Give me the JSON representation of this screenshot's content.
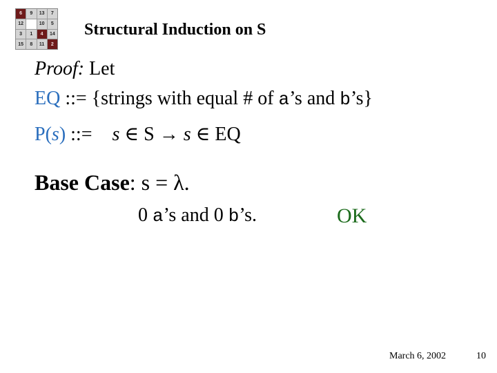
{
  "slide": {
    "title": "Structural Induction on S",
    "logo": {
      "tiles": [
        {
          "label": "6",
          "style": "dark"
        },
        {
          "label": "9",
          "style": "light"
        },
        {
          "label": "13",
          "style": "light"
        },
        {
          "label": "7",
          "style": "light"
        },
        {
          "label": "12",
          "style": "light"
        },
        {
          "label": "",
          "style": "blank"
        },
        {
          "label": "10",
          "style": "light"
        },
        {
          "label": "5",
          "style": "light"
        },
        {
          "label": "3",
          "style": "light"
        },
        {
          "label": "1",
          "style": "light"
        },
        {
          "label": "4",
          "style": "dark"
        },
        {
          "label": "14",
          "style": "light"
        },
        {
          "label": "15",
          "style": "light"
        },
        {
          "label": "8",
          "style": "light"
        },
        {
          "label": "11",
          "style": "light"
        },
        {
          "label": "2",
          "style": "dark"
        }
      ]
    },
    "proof_line": {
      "proof_label": "Proof:",
      "let_text": " Let"
    },
    "eq_line": {
      "name": "EQ",
      "def": " ::= {strings with equal # of ",
      "a": "a",
      "mid": "’s and ",
      "b": "b",
      "end": "’s}"
    },
    "p_line": {
      "p": "P(",
      "s": "s",
      "p_close": ")",
      "def": " ::= ",
      "s1": "s",
      "in1": " ∈ S → ",
      "s2": "s",
      "in2": " ∈ EQ"
    },
    "base_case": {
      "label": "Base Case",
      "rest": ": s = λ."
    },
    "counts_line": {
      "zero1": "0 ",
      "a": "a",
      "mid": "’s and 0 ",
      "b": "b",
      "end": "’s."
    },
    "ok": "OK",
    "footer": {
      "date": "March 6, 2002",
      "page": "10"
    },
    "colors": {
      "definition_blue": "#2a6ebd",
      "ok_green": "#1c6b1c",
      "logo_dark_tile": "#6e1a1a",
      "logo_light_tile": "#d4d4d4"
    }
  }
}
